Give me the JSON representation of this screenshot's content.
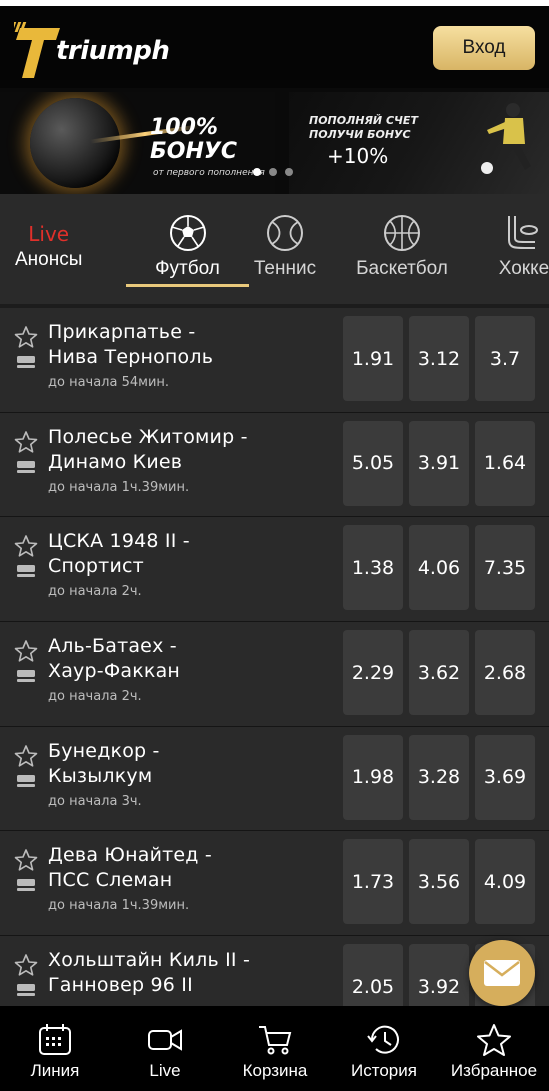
{
  "header": {
    "logo_text": "triumph",
    "login_label": "Вход"
  },
  "banners": [
    {
      "big": "100%",
      "big2": "БОНУС",
      "small": "от первого пополнения"
    },
    {
      "line1": "ПОПОЛНЯЙ СЧЕТ",
      "line2": "ПОЛУЧИ БОНУС",
      "big": "+10%"
    }
  ],
  "tabs": {
    "live": "Live",
    "anons": "Анонсы",
    "sports": [
      {
        "label": "Футбол",
        "icon": "soccer-ball-icon",
        "active": true
      },
      {
        "label": "Теннис",
        "icon": "tennis-ball-icon",
        "active": false
      },
      {
        "label": "Баскетбол",
        "icon": "basketball-icon",
        "active": false
      },
      {
        "label": "Хокке",
        "icon": "hockey-icon",
        "active": false
      }
    ]
  },
  "matches": [
    {
      "home": "Прикарпатье -",
      "away": "Нива Тернополь",
      "time": "до начала 54мин.",
      "odds": [
        "1.91",
        "3.12",
        "3.7"
      ]
    },
    {
      "home": "Полесье Житомир -",
      "away": "Динамо Киев",
      "time": "до начала 1ч.39мин.",
      "odds": [
        "5.05",
        "3.91",
        "1.64"
      ]
    },
    {
      "home": "ЦСКА 1948 II -",
      "away": "Спортист",
      "time": "до начала 2ч.",
      "odds": [
        "1.38",
        "4.06",
        "7.35"
      ]
    },
    {
      "home": "Аль-Батаех -",
      "away": "Хаур-Факкан",
      "time": "до начала 2ч.",
      "odds": [
        "2.29",
        "3.62",
        "2.68"
      ]
    },
    {
      "home": "Бунедкор -",
      "away": "Кызылкум",
      "time": "до начала 3ч.",
      "odds": [
        "1.98",
        "3.28",
        "3.69"
      ]
    },
    {
      "home": "Дева Юнайтед -",
      "away": "ПСС Слеман",
      "time": "до начала 1ч.39мин.",
      "odds": [
        "1.73",
        "3.56",
        "4.09"
      ]
    },
    {
      "home": "Хольштайн Киль II -",
      "away": "Ганновер 96 II",
      "time": "",
      "odds": [
        "2.05",
        "3.92",
        ""
      ]
    }
  ],
  "bottom_nav": [
    {
      "label": "Линия",
      "icon": "calendar-icon"
    },
    {
      "label": "Live",
      "icon": "video-camera-icon"
    },
    {
      "label": "Корзина",
      "icon": "cart-icon"
    },
    {
      "label": "История",
      "icon": "history-icon"
    },
    {
      "label": "Избранное",
      "icon": "star-icon"
    }
  ],
  "colors": {
    "accent": "#e9c97c",
    "live_red": "#e0302a",
    "background": "#2a2a2a",
    "odd_cell": "#3b3b3b"
  }
}
